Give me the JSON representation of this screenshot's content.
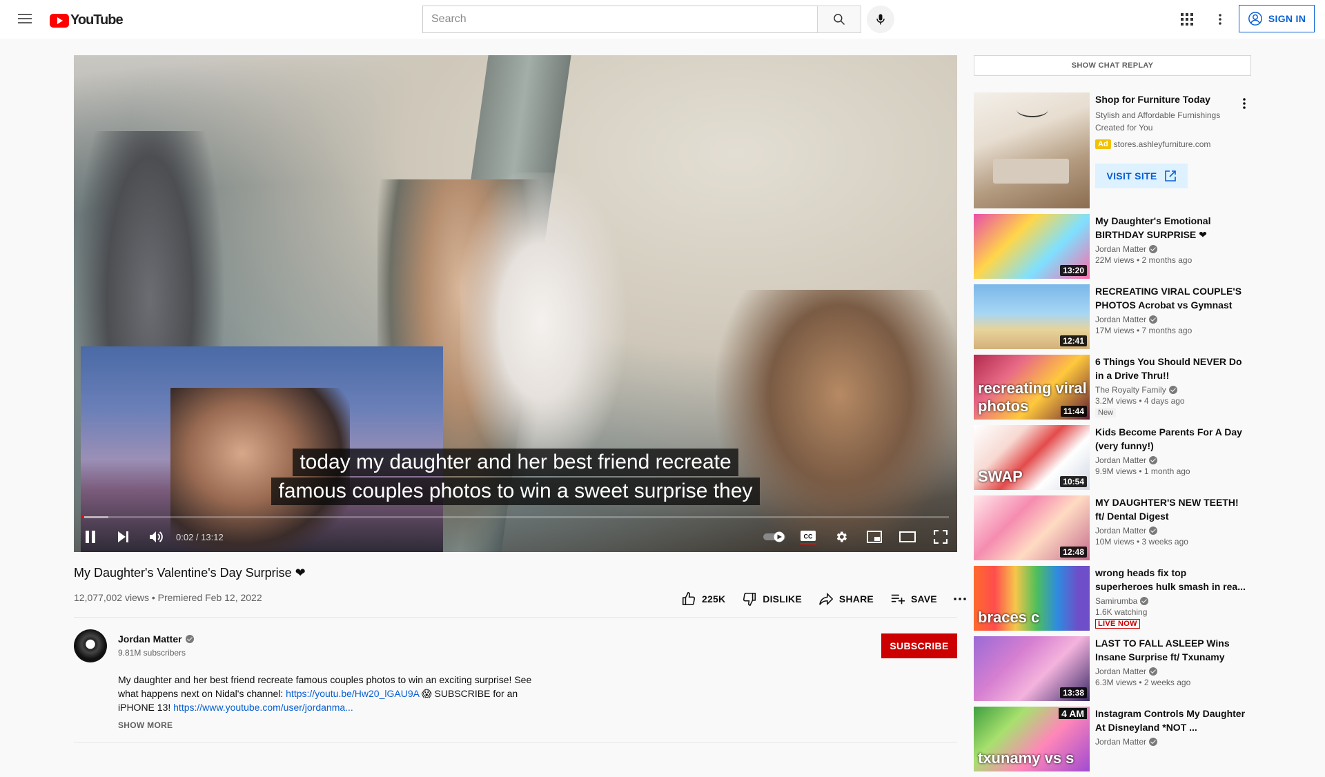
{
  "header": {
    "logo_text": "YouTube",
    "search_placeholder": "Search",
    "signin_label": "SIGN IN"
  },
  "player": {
    "captions": [
      "today my daughter and her best friend recreate",
      "famous couples photos to win a sweet surprise they"
    ],
    "time_current": "0:02",
    "time_total": "13:12",
    "time_display": "0:02 / 13:12",
    "progress_fraction": 0.0025,
    "loaded_fraction": 0.03
  },
  "video": {
    "title": "My Daughter's Valentine's Day Surprise ❤",
    "meta": "12,077,002 views • Premiered Feb 12, 2022",
    "likes": "225K",
    "dislike_label": "DISLIKE",
    "share_label": "SHARE",
    "save_label": "SAVE"
  },
  "channel": {
    "name": "Jordan Matter",
    "subscribers": "9.81M subscribers",
    "subscribe_label": "SUBSCRIBE"
  },
  "description": {
    "text1": "My daughter and her best friend recreate famous couples photos to win an exciting surprise! See what happens next on Nidal's channel: ",
    "link1": "https://youtu.be/Hw20_lGAU9A",
    "text2": " 😱 SUBSCRIBE for an iPHONE 13! ",
    "link2": "https://www.youtube.com/user/jordanma...",
    "show_more": "SHOW MORE"
  },
  "sidebar": {
    "chat_replay": "SHOW CHAT REPLAY",
    "ad": {
      "title": "Shop for Furniture Today",
      "subtitle": "Stylish and Affordable Furnishings Created for You",
      "badge": "Ad",
      "domain": "stores.ashleyfurniture.com",
      "visit_label": "VISIT SITE"
    },
    "recommendations": [
      {
        "title": "My Daughter's Emotional BIRTHDAY SURPRISE ❤",
        "channel": "Jordan Matter",
        "verified": true,
        "stats": "22M views • 2 months ago",
        "duration": "13:20",
        "thumb_class": "t1",
        "badge": ""
      },
      {
        "title": "RECREATING VIRAL COUPLE'S PHOTOS Acrobat vs Gymnast",
        "channel": "Jordan Matter",
        "verified": true,
        "stats": "17M views • 7 months ago",
        "duration": "12:41",
        "thumb_class": "t2",
        "badge": ""
      },
      {
        "title": "6 Things You Should NEVER Do in a Drive Thru!!",
        "channel": "The Royalty Family",
        "verified": true,
        "stats": "3.2M views • 4 days ago",
        "duration": "11:44",
        "thumb_class": "t3",
        "badge": "New"
      },
      {
        "title": "Kids Become Parents For A Day (very funny!)",
        "channel": "Jordan Matter",
        "verified": true,
        "stats": "9.9M views • 1 month ago",
        "duration": "10:54",
        "thumb_class": "t4",
        "badge": ""
      },
      {
        "title": "MY DAUGHTER'S NEW TEETH! ft/ Dental Digest",
        "channel": "Jordan Matter",
        "verified": true,
        "stats": "10M views • 3 weeks ago",
        "duration": "12:48",
        "thumb_class": "t5",
        "badge": ""
      },
      {
        "title": "wrong heads fix top superheroes hulk smash in rea...",
        "channel": "Samirumba",
        "verified": true,
        "stats": "1.6K watching",
        "duration": "",
        "thumb_class": "t6",
        "badge": "LIVE NOW"
      },
      {
        "title": "LAST TO FALL ASLEEP Wins Insane Surprise ft/ Txunamy",
        "channel": "Jordan Matter",
        "verified": true,
        "stats": "6.3M views • 2 weeks ago",
        "duration": "13:38",
        "thumb_class": "t7",
        "badge": ""
      },
      {
        "title": "Instagram Controls My Daughter At Disneyland *NOT ...",
        "channel": "Jordan Matter",
        "verified": true,
        "stats": "",
        "duration": "",
        "thumb_class": "t8",
        "badge": ""
      }
    ],
    "thumb_overlays": {
      "rec2": "recreating viral photos",
      "rec3": "SWAP",
      "rec5": "braces c",
      "rec7": "txunamy vs s",
      "rec7_corner": "4 AM"
    }
  }
}
